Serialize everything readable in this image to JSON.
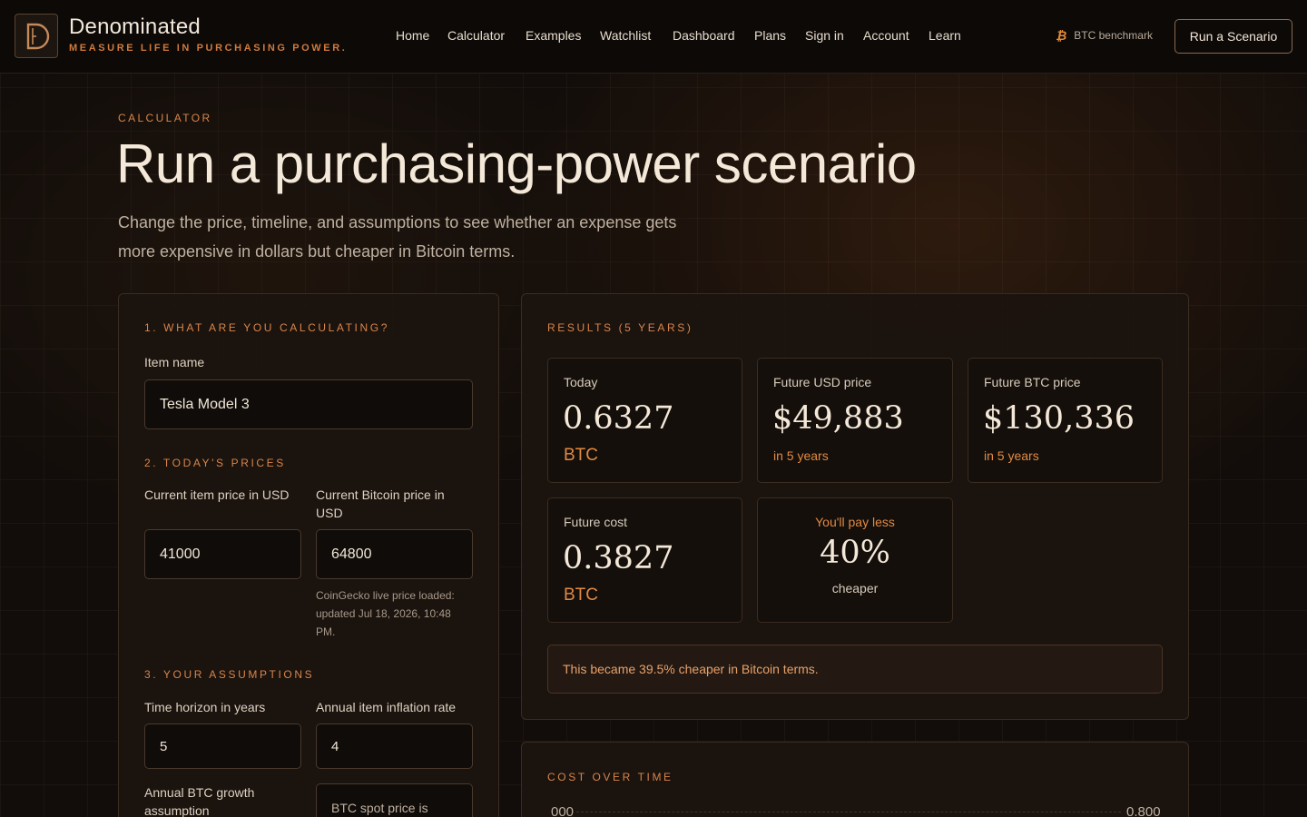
{
  "brand": {
    "name": "Denominated",
    "tagline": "MEASURE LIFE IN PURCHASING POWER."
  },
  "nav": [
    "Home",
    "Calculator",
    "Examples",
    "Watchlist",
    "Dashboard",
    "Plans",
    "Sign in",
    "Account",
    "Learn"
  ],
  "header": {
    "benchmark_label": "BTC benchmark",
    "cta_label": "Run a Scenario"
  },
  "hero": {
    "eyebrow": "CALCULATOR",
    "title": "Run a purchasing-power scenario",
    "subtitle": "Change the price, timeline, and assumptions to see whether an expense gets more expensive in dollars but cheaper in Bitcoin terms."
  },
  "form": {
    "section1": "1. WHAT ARE YOU CALCULATING?",
    "item_name_label": "Item name",
    "item_name_value": "Tesla Model 3",
    "section2": "2. TODAY'S PRICES",
    "item_price_label": "Current item price in USD",
    "item_price_value": "41000",
    "btc_price_label": "Current Bitcoin price in USD",
    "btc_price_value": "64800",
    "price_note": "CoinGecko live price loaded: updated Jul 18, 2026, 10:48 PM.",
    "section3": "3. YOUR ASSUMPTIONS",
    "horizon_label": "Time horizon in years",
    "horizon_value": "5",
    "inflation_label": "Annual item inflation rate",
    "inflation_value": "4",
    "btc_growth_label": "Annual BTC growth assumption",
    "btc_spot_note": "BTC spot price is"
  },
  "results": {
    "heading": "RESULTS (5 YEARS)",
    "today_label": "Today",
    "today_value": "0.6327",
    "today_unit": "BTC",
    "future_usd_label": "Future USD price",
    "future_usd_value": "$49,883",
    "future_usd_sub": "in 5 years",
    "future_btc_label": "Future BTC price",
    "future_btc_value": "$130,336",
    "future_btc_sub": "in 5 years",
    "future_cost_label": "Future cost",
    "future_cost_value": "0.3827",
    "future_cost_unit": "BTC",
    "pay_less_label": "You'll pay less",
    "pay_less_value": "40%",
    "pay_less_sub": "cheaper",
    "callout": "This became 39.5% cheaper in Bitcoin terms."
  },
  "chart": {
    "heading": "COST OVER TIME",
    "left_tick": "000",
    "right_tick": "0.800"
  },
  "colors": {
    "accent": "#d9854a",
    "background": "#120d0a",
    "text": "#f4e8d8"
  }
}
